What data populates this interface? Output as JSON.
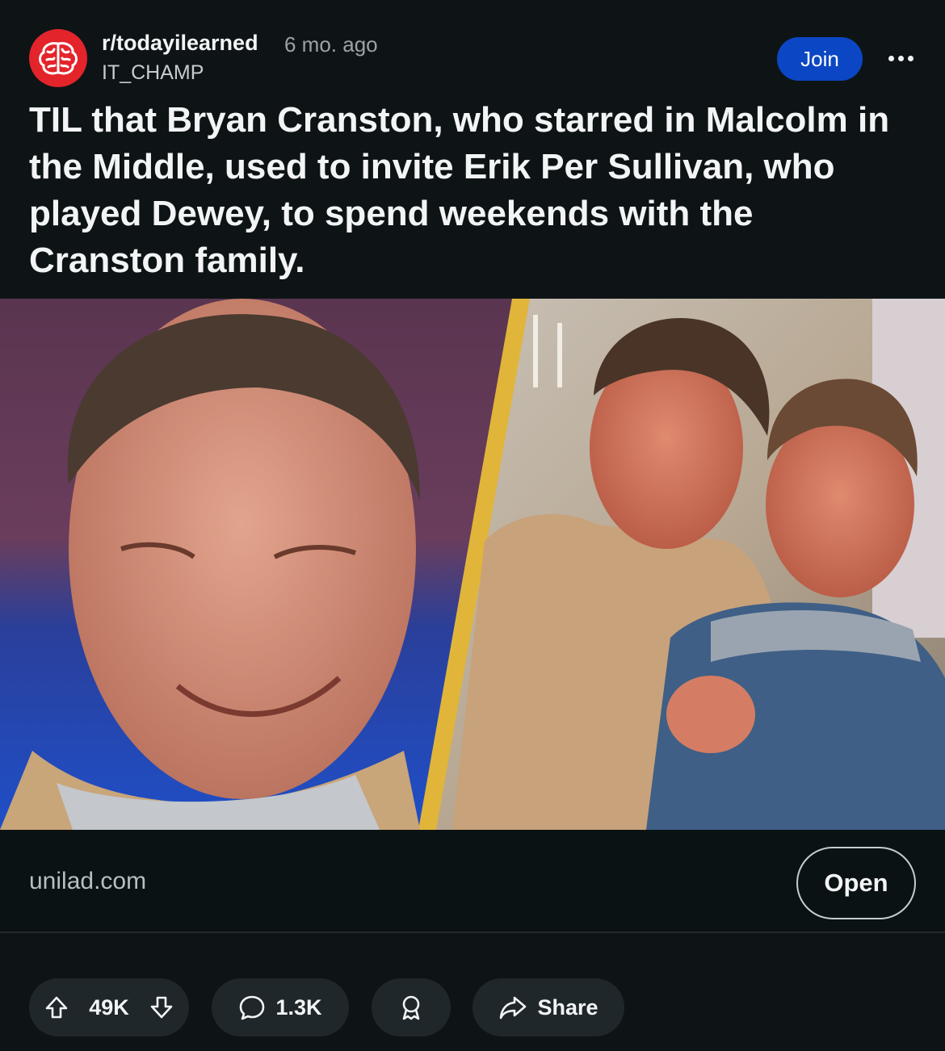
{
  "post": {
    "subreddit": "r/todayilearned",
    "time": "6 mo. ago",
    "author": "IT_CHAMP",
    "join_label": "Join",
    "title": "TIL that Bryan Cranston, who starred in Malcolm in the Middle, used to invite Erik Per Sullivan, who played Dewey, to spend weekends with the Cranston family."
  },
  "link": {
    "domain": "unilad.com",
    "open_label": "Open"
  },
  "actions": {
    "votes": "49K",
    "comments": "1.3K",
    "share_label": "Share"
  },
  "colors": {
    "background": "#0e1416",
    "join_button": "#0b46c4",
    "subreddit_icon": "#e3242b",
    "divider_stripe": "#e0b53a"
  },
  "icons": [
    "brain-icon",
    "more-icon",
    "upvote-icon",
    "downvote-icon",
    "comment-icon",
    "award-icon",
    "share-icon"
  ]
}
